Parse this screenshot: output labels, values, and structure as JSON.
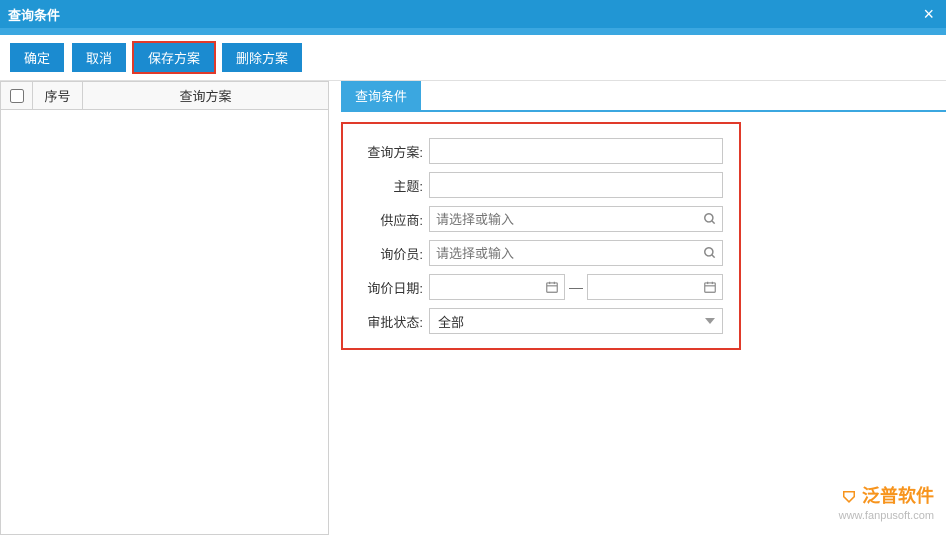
{
  "titlebar": {
    "title": "查询条件"
  },
  "toolbar": {
    "confirm_label": "确定",
    "cancel_label": "取消",
    "save_plan_label": "保存方案",
    "delete_plan_label": "删除方案"
  },
  "grid": {
    "col_seq": "序号",
    "col_plan": "查询方案",
    "rows": []
  },
  "tab": {
    "conditions_label": "查询条件"
  },
  "form": {
    "plan": {
      "label": "查询方案:",
      "value": ""
    },
    "subject": {
      "label": "主题:",
      "value": ""
    },
    "supplier": {
      "label": "供应商:",
      "placeholder": "请选择或输入"
    },
    "inquirer": {
      "label": "询价员:",
      "placeholder": "请选择或输入"
    },
    "inquiry_date": {
      "label": "询价日期:",
      "from": "",
      "to": "",
      "sep": "—"
    },
    "approval_status": {
      "label": "审批状态:",
      "value": "全部",
      "options": [
        "全部"
      ]
    }
  },
  "watermark": {
    "brand": "泛普软件",
    "url": "www.fanpusoft.com"
  }
}
